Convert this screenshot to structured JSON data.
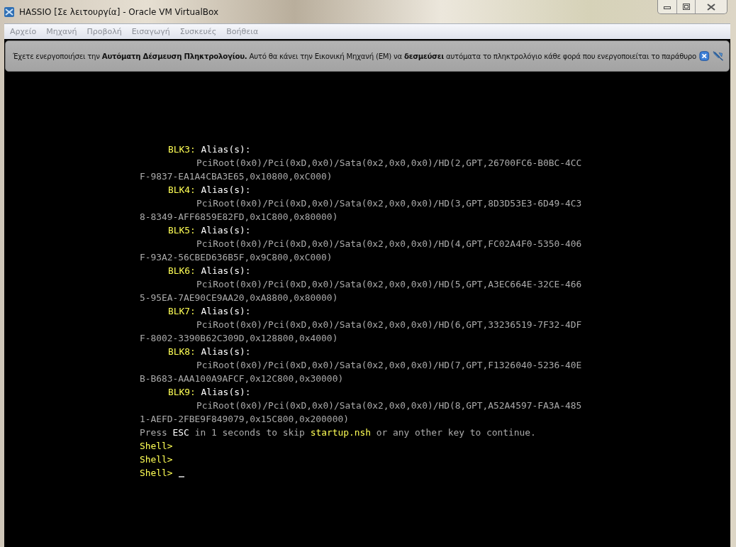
{
  "window": {
    "title": "HASSIO [Σε λειτουργία] - Oracle VM VirtualBox"
  },
  "menu": [
    {
      "label": "Αρχείο",
      "disabled": true
    },
    {
      "label": "Μηχανή",
      "disabled": true
    },
    {
      "label": "Προβολή",
      "disabled": true
    },
    {
      "label": "Εισαγωγή",
      "disabled": true
    },
    {
      "label": "Συσκευές",
      "disabled": true
    },
    {
      "label": "Βοήθεια",
      "disabled": true
    }
  ],
  "notice": {
    "message": "Έχετε ενεργοποιήσει την **Αυτόματη Δέσμευση Πληκτρολογίου.** Αυτό θα κάνει την Εικονική Μηχανή (ΕΜ) να **δεσμεύσει** αυτόματα το πληκτρολόγιο κάθε φορά που ενεργοποιείται το παράθυρο"
  },
  "terminal": {
    "cursor": true,
    "lines": [
      {
        "kind": "label",
        "segments": [
          {
            "text": "BLK3:",
            "color": "#ffff55"
          },
          {
            "text": " Alias(s):",
            "color": "#ffffff"
          }
        ]
      },
      {
        "kind": "path",
        "segments": [
          {
            "text": "PciRoot(0x0)/Pci(0xD,0x0)/Sata(0x2,0x0,0x0)/HD(2,GPT,26700FC6-B0BC-4CC",
            "color": "#aaaaaa"
          }
        ]
      },
      {
        "kind": "wrap",
        "segments": [
          {
            "text": "F-9837-EA1A4CBA3E65,0x10800,0xC000)",
            "color": "#aaaaaa"
          }
        ]
      },
      {
        "kind": "label",
        "segments": [
          {
            "text": "BLK4:",
            "color": "#ffff55"
          },
          {
            "text": " Alias(s):",
            "color": "#ffffff"
          }
        ]
      },
      {
        "kind": "path",
        "segments": [
          {
            "text": "PciRoot(0x0)/Pci(0xD,0x0)/Sata(0x2,0x0,0x0)/HD(3,GPT,8D3D53E3-6D49-4C3",
            "color": "#aaaaaa"
          }
        ]
      },
      {
        "kind": "wrap",
        "segments": [
          {
            "text": "8-8349-AFF6859E82FD,0x1C800,0x80000)",
            "color": "#aaaaaa"
          }
        ]
      },
      {
        "kind": "label",
        "segments": [
          {
            "text": "BLK5:",
            "color": "#ffff55"
          },
          {
            "text": " Alias(s):",
            "color": "#ffffff"
          }
        ]
      },
      {
        "kind": "path",
        "segments": [
          {
            "text": "PciRoot(0x0)/Pci(0xD,0x0)/Sata(0x2,0x0,0x0)/HD(4,GPT,FC02A4F0-5350-406",
            "color": "#aaaaaa"
          }
        ]
      },
      {
        "kind": "wrap",
        "segments": [
          {
            "text": "F-93A2-56CBED636B5F,0x9C800,0xC000)",
            "color": "#aaaaaa"
          }
        ]
      },
      {
        "kind": "label",
        "segments": [
          {
            "text": "BLK6:",
            "color": "#ffff55"
          },
          {
            "text": " Alias(s):",
            "color": "#ffffff"
          }
        ]
      },
      {
        "kind": "path",
        "segments": [
          {
            "text": "PciRoot(0x0)/Pci(0xD,0x0)/Sata(0x2,0x0,0x0)/HD(5,GPT,A3EC664E-32CE-466",
            "color": "#aaaaaa"
          }
        ]
      },
      {
        "kind": "wrap",
        "segments": [
          {
            "text": "5-95EA-7AE90CE9AA20,0xA8800,0x80000)",
            "color": "#aaaaaa"
          }
        ]
      },
      {
        "kind": "label",
        "segments": [
          {
            "text": "BLK7:",
            "color": "#ffff55"
          },
          {
            "text": " Alias(s):",
            "color": "#ffffff"
          }
        ]
      },
      {
        "kind": "path",
        "segments": [
          {
            "text": "PciRoot(0x0)/Pci(0xD,0x0)/Sata(0x2,0x0,0x0)/HD(6,GPT,33236519-7F32-4DF",
            "color": "#aaaaaa"
          }
        ]
      },
      {
        "kind": "wrap",
        "segments": [
          {
            "text": "F-8002-3390B62C309D,0x128800,0x4000)",
            "color": "#aaaaaa"
          }
        ]
      },
      {
        "kind": "label",
        "segments": [
          {
            "text": "BLK8:",
            "color": "#ffff55"
          },
          {
            "text": " Alias(s):",
            "color": "#ffffff"
          }
        ]
      },
      {
        "kind": "path",
        "segments": [
          {
            "text": "PciRoot(0x0)/Pci(0xD,0x0)/Sata(0x2,0x0,0x0)/HD(7,GPT,F1326040-5236-40E",
            "color": "#aaaaaa"
          }
        ]
      },
      {
        "kind": "wrap",
        "segments": [
          {
            "text": "B-B683-AAA100A9AFCF,0x12C800,0x30000)",
            "color": "#aaaaaa"
          }
        ]
      },
      {
        "kind": "label",
        "segments": [
          {
            "text": "BLK9:",
            "color": "#ffff55"
          },
          {
            "text": " Alias(s):",
            "color": "#ffffff"
          }
        ]
      },
      {
        "kind": "path",
        "segments": [
          {
            "text": "PciRoot(0x0)/Pci(0xD,0x0)/Sata(0x2,0x0,0x0)/HD(8,GPT,A52A4597-FA3A-485",
            "color": "#aaaaaa"
          }
        ]
      },
      {
        "kind": "wrap",
        "segments": [
          {
            "text": "1-AEFD-2FBE9F849079,0x15C800,0x200000)",
            "color": "#aaaaaa"
          }
        ]
      },
      {
        "kind": "wrap",
        "segments": [
          {
            "text": "Press ",
            "color": "#aaaaaa"
          },
          {
            "text": "ESC",
            "color": "#ffffff"
          },
          {
            "text": " in 1 seconds to skip ",
            "color": "#aaaaaa"
          },
          {
            "text": "startup.nsh",
            "color": "#ffff55"
          },
          {
            "text": " or any other key to continue.",
            "color": "#aaaaaa"
          }
        ]
      },
      {
        "kind": "wrap",
        "segments": [
          {
            "text": "Shell>",
            "color": "#ffff55"
          }
        ]
      },
      {
        "kind": "wrap",
        "segments": [
          {
            "text": "Shell>",
            "color": "#ffff55"
          }
        ]
      },
      {
        "kind": "wrap",
        "segments": [
          {
            "text": "Shell>",
            "color": "#ffff55"
          }
        ]
      }
    ]
  }
}
